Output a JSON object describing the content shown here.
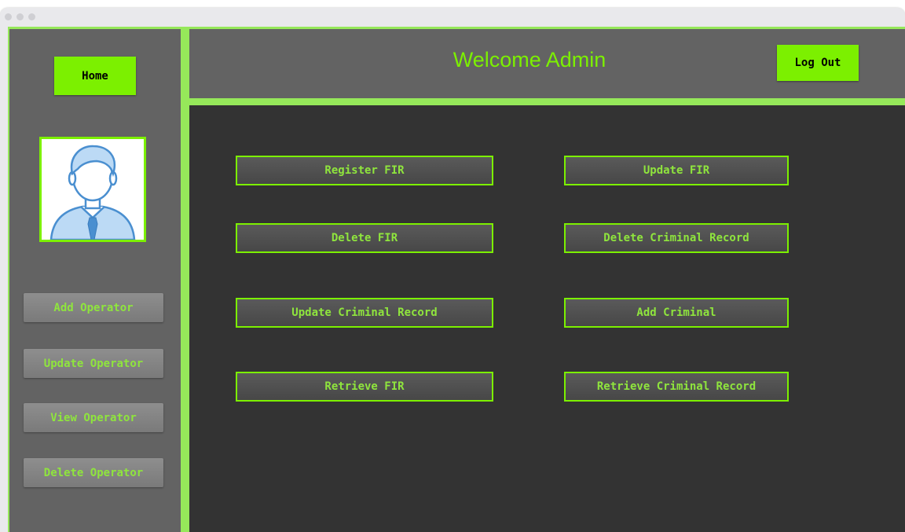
{
  "sidebar": {
    "home_label": "Home",
    "avatar_icon": "user-avatar-icon",
    "buttons": [
      {
        "label": "Add Operator"
      },
      {
        "label": "Update Operator"
      },
      {
        "label": "View Operator"
      },
      {
        "label": "Delete Operator"
      }
    ]
  },
  "header": {
    "title": "Welcome Admin",
    "logout_label": "Log Out"
  },
  "main": {
    "actions": [
      {
        "label": "Register FIR"
      },
      {
        "label": "Update FIR"
      },
      {
        "label": "Delete FIR"
      },
      {
        "label": "Delete Criminal Record"
      },
      {
        "label": "Update Criminal Record"
      },
      {
        "label": "Add Criminal"
      },
      {
        "label": "Retrieve FIR"
      },
      {
        "label": "Retrieve Criminal Record"
      }
    ]
  },
  "colors": {
    "accent": "#7cf000",
    "panel": "#636363",
    "main_bg": "#333333",
    "border": "#96e85a"
  }
}
